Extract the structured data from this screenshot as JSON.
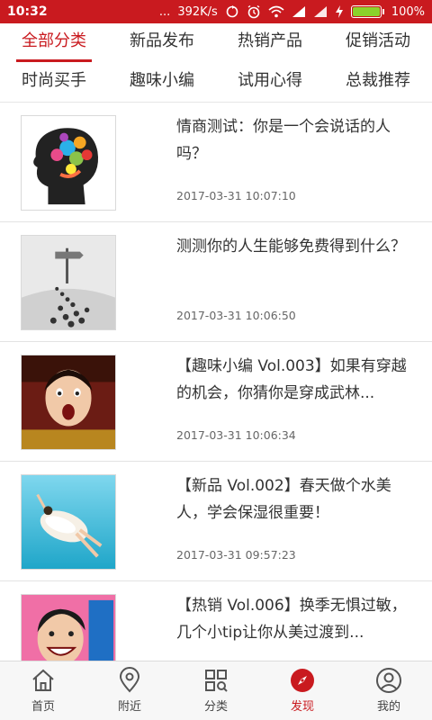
{
  "status": {
    "time": "10:32",
    "dots": "...",
    "speed": "392K/s",
    "battery": "100%"
  },
  "tabs": {
    "row1": [
      {
        "label": "全部分类",
        "active": true
      },
      {
        "label": "新品发布",
        "active": false
      },
      {
        "label": "热销产品",
        "active": false
      },
      {
        "label": "促销活动",
        "active": false
      }
    ],
    "row2": [
      {
        "label": "时尚买手"
      },
      {
        "label": "趣味小编"
      },
      {
        "label": "试用心得"
      },
      {
        "label": "总裁推荐"
      }
    ]
  },
  "articles": [
    {
      "title": "情商测试：你是一个会说话的人吗？",
      "date": "2017-03-31 10:07:10",
      "thumb": "colorful-head-illustration"
    },
    {
      "title": "测测你的人生能够免费得到什么？",
      "date": "2017-03-31 10:06:50",
      "thumb": "crowd-at-signpost"
    },
    {
      "title": "【趣味小编 Vol.003】如果有穿越的机会，你猜你是穿成武林...",
      "date": "2017-03-31 10:06:34",
      "thumb": "surprised-woman-costume"
    },
    {
      "title": "【新品 Vol.002】春天做个水美人，学会保湿很重要！",
      "date": "2017-03-31 09:57:23",
      "thumb": "underwater-dancer"
    },
    {
      "title": "【热销 Vol.006】换季无惧过敏，几个小tip让你从美过渡到...",
      "date": "",
      "thumb": "smiling-man-tv-show"
    }
  ],
  "bottom_nav": [
    {
      "label": "首页",
      "icon": "home-icon"
    },
    {
      "label": "附近",
      "icon": "location-pin-icon"
    },
    {
      "label": "分类",
      "icon": "category-grid-icon"
    },
    {
      "label": "发现",
      "icon": "compass-icon",
      "active": true
    },
    {
      "label": "我的",
      "icon": "user-icon"
    }
  ],
  "colors": {
    "brand": "#c91a1f",
    "battery": "#8bd22b"
  }
}
